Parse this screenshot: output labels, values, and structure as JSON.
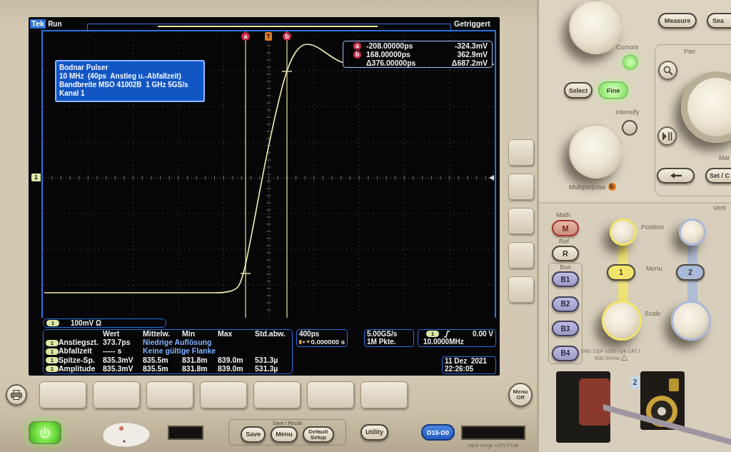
{
  "screen": {
    "brand": "Tek",
    "run_state": "Run",
    "trigger_state": "Getriggert",
    "info_box": [
      "Bodnar Pulser",
      "10 MHz  (40ps  Anstieg u.-Abfallzeit)",
      "Bandbreite MSO 41002B  1 GHz 5GS/s",
      "Kanal 1"
    ],
    "markers": [
      {
        "kind": "cursor",
        "label": "a"
      },
      {
        "kind": "trigger",
        "label": "T"
      },
      {
        "kind": "cursor",
        "label": "b"
      }
    ],
    "channel_marker": "1",
    "cursor_readout": [
      {
        "kind": "cursor",
        "label": "a",
        "time": "-208.00000ps",
        "value": "-324.3mV"
      },
      {
        "kind": "cursor",
        "label": "b",
        "time": "168.00000ps",
        "value": "362.9mV"
      },
      {
        "kind": "delta",
        "time": "Δ376.00000ps",
        "value": "Δ687.2mV"
      }
    ],
    "channel_bar": {
      "channel": "1",
      "scale": "100mV Ω"
    },
    "measurements": {
      "columns": [
        "Wert",
        "Mittelw.",
        "Min",
        "Max",
        "Std.abw."
      ],
      "rows": [
        {
          "kind": "note",
          "channel": "1",
          "name": "Anstiegszt.",
          "value": "373.7ps",
          "note": "Niedrige Auflösung"
        },
        {
          "kind": "note",
          "channel": "1",
          "name": "Abfallzeit",
          "value": "----- s",
          "note": "Keine gültige Flanke"
        },
        {
          "kind": "stats",
          "channel": "1",
          "name": "Spitze-Sp.",
          "value": "835.3mV",
          "stats": [
            "835.5m",
            "831.8m",
            "839.0m",
            "531.3µ"
          ]
        },
        {
          "kind": "stats",
          "channel": "1",
          "name": "Amplitude",
          "value": "835.3mV",
          "stats": [
            "835.5m",
            "831.8m",
            "839.0m",
            "531.3µ"
          ]
        }
      ]
    },
    "horizontal": {
      "scale": "400ps",
      "position": "0.000000 s"
    },
    "acquisition": {
      "sample_rate": "5.00GS/s",
      "record_length": "1M Pkte."
    },
    "trigger": {
      "channel": "1",
      "level": "0.00 V",
      "frequency": "10.0000MHz"
    },
    "date": "11 Dez  2021",
    "time": "22:26:05"
  },
  "front_panel": {
    "top_buttons": [
      "Measure",
      "Sea"
    ],
    "cursors": {
      "label": "Cursors",
      "lit": true
    },
    "select": "Select",
    "fine": {
      "label": "Fine",
      "lit": true
    },
    "intensify": {
      "label": "Intensify",
      "lit": false
    },
    "multipurpose": {
      "label": "Multipurpose",
      "badge": "b"
    },
    "pan_zoom": {
      "label": "Pan",
      "mark_label": "Mar",
      "set_button": "Set / C"
    },
    "vertical": {
      "title": "Verti",
      "math_label": "Math",
      "math_button": "M",
      "ref_label": "Ref",
      "ref_button": "R",
      "bus_label": "Bus",
      "bus_buttons": [
        "B1",
        "B2",
        "B3",
        "B4"
      ],
      "position_label": "Position",
      "menu_label": "Menu",
      "scale_label": "Scale",
      "channels": [
        {
          "label": "1",
          "color": "#f2e46a"
        },
        {
          "label": "2",
          "color": "#a9b9d8"
        }
      ],
      "ratings": [
        "1MΩ 13pF ≤300 Vpk CAT I",
        "50Ω 5Vrms"
      ],
      "input_label": "2"
    }
  },
  "bottom_panel": {
    "menu_off": "Menu Off",
    "power": {
      "on": true
    },
    "save_recall": {
      "title": "Save / Recall",
      "buttons": [
        "Save",
        "Menu",
        "Default Setup"
      ]
    },
    "utility": "Utility",
    "digital": "D15-D0",
    "input_range": "Input range ±42V Peak"
  }
}
